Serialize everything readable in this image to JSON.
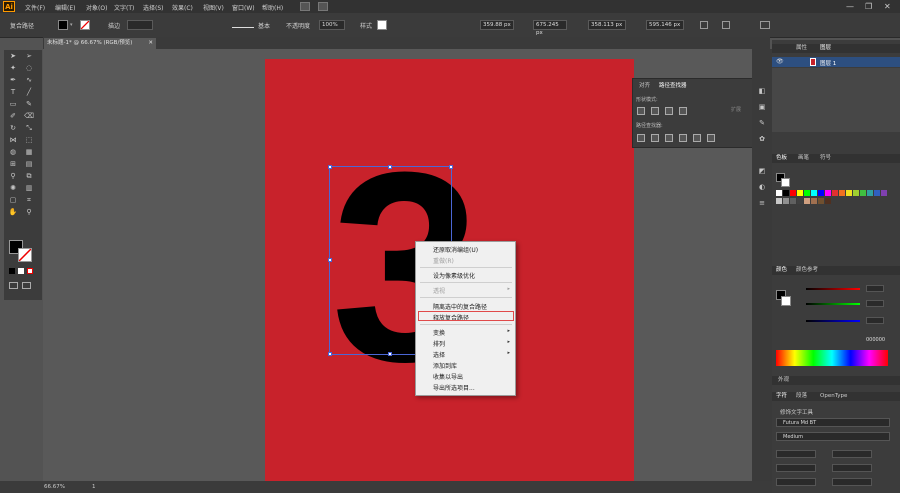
{
  "menubar": {
    "logo": "Ai",
    "items": [
      "文件(F)",
      "编辑(E)",
      "对象(O)",
      "文字(T)",
      "选择(S)",
      "效果(C)",
      "视图(V)",
      "窗口(W)",
      "帮助(H)"
    ],
    "window_controls": [
      "—",
      "❐",
      "✕"
    ]
  },
  "options_bar": {
    "label": "复合路径",
    "stroke_label": "描边",
    "stroke_style": "基本",
    "opacity_label": "不透明度",
    "opacity_value": "100%",
    "style_label": "样式",
    "x_value": "359.88 px",
    "y_value": "675.245 px",
    "w_value": "358.113 px",
    "h_value": "595.146 px"
  },
  "document_tab": {
    "title": "未标题-1* @ 66.67% (RGB/预览)",
    "close": "✕"
  },
  "artboard": {
    "digit": "3",
    "color": "#c8222b"
  },
  "context_menu": {
    "items": [
      {
        "label": "还原取消编组(U)",
        "disabled": false,
        "submenu": false
      },
      {
        "label": "重做(R)",
        "disabled": true,
        "submenu": false
      },
      {
        "label": "设为像素级优化",
        "disabled": false,
        "submenu": false
      },
      {
        "label": "透视",
        "disabled": true,
        "submenu": true
      },
      {
        "label": "隔离选中的复合路径",
        "disabled": false,
        "submenu": false
      },
      {
        "label": "释放复合路径",
        "disabled": false,
        "submenu": false,
        "highlighted": true
      },
      {
        "label": "变换",
        "disabled": false,
        "submenu": true
      },
      {
        "label": "排列",
        "disabled": false,
        "submenu": true
      },
      {
        "label": "选择",
        "disabled": false,
        "submenu": true
      },
      {
        "label": "添加到库",
        "disabled": false,
        "submenu": false
      },
      {
        "label": "收集以导出",
        "disabled": false,
        "submenu": false
      },
      {
        "label": "导出所选项目...",
        "disabled": false,
        "submenu": false
      }
    ]
  },
  "pathfinder": {
    "tabs": [
      "对齐",
      "路径查找器"
    ],
    "shape_modes_label": "形状模式:",
    "pathfinders_label": "路径查找器:",
    "expand_label": "扩展"
  },
  "layers_panel": {
    "tabs": [
      "属性",
      "图层"
    ],
    "layer_name": "图层 1"
  },
  "swatches_panel": {
    "tabs": [
      "色板",
      "画笔",
      "符号"
    ]
  },
  "color_panel": {
    "tabs": [
      "颜色",
      "颜色参考"
    ],
    "hex": "000000"
  },
  "character_panel": {
    "tabs": [
      "字符",
      "段落",
      "OpenType"
    ],
    "touch_tool": "修饰文字工具",
    "font_name": "Futura Md BT",
    "font_style": "Medium"
  },
  "appearance_label": "外观",
  "status": {
    "zoom": "66.67%",
    "page": "1"
  }
}
